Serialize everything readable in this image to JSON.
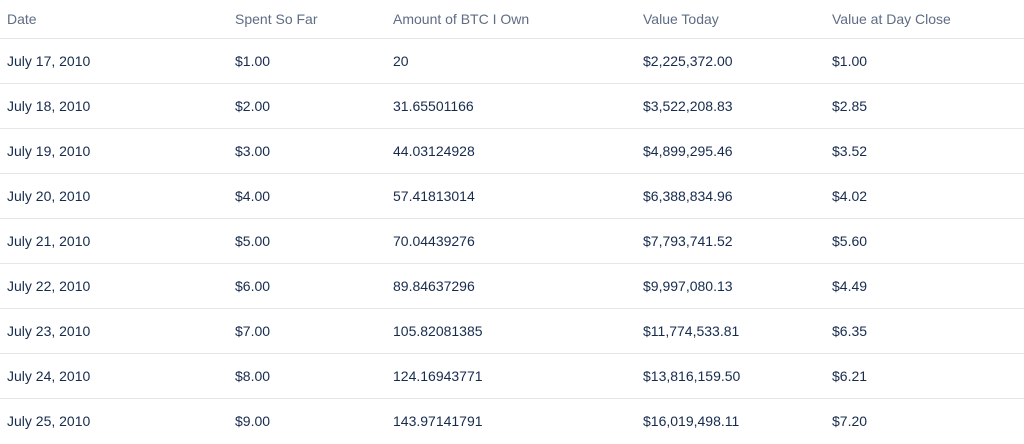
{
  "table": {
    "headers": [
      "Date",
      "Spent So Far",
      "Amount of BTC I Own",
      "Value Today",
      "Value at Day Close"
    ],
    "rows": [
      [
        "July 17, 2010",
        "$1.00",
        "20",
        "$2,225,372.00",
        "$1.00"
      ],
      [
        "July 18, 2010",
        "$2.00",
        "31.65501166",
        "$3,522,208.83",
        "$2.85"
      ],
      [
        "July 19, 2010",
        "$3.00",
        "44.03124928",
        "$4,899,295.46",
        "$3.52"
      ],
      [
        "July 20, 2010",
        "$4.00",
        "57.41813014",
        "$6,388,834.96",
        "$4.02"
      ],
      [
        "July 21, 2010",
        "$5.00",
        "70.04439276",
        "$7,793,741.52",
        "$5.60"
      ],
      [
        "July 22, 2010",
        "$6.00",
        "89.84637296",
        "$9,997,080.13",
        "$4.49"
      ],
      [
        "July 23, 2010",
        "$7.00",
        "105.82081385",
        "$11,774,533.81",
        "$6.35"
      ],
      [
        "July 24, 2010",
        "$8.00",
        "124.16943771",
        "$13,816,159.50",
        "$6.21"
      ],
      [
        "July 25, 2010",
        "$9.00",
        "143.97141791",
        "$16,019,498.11",
        "$7.20"
      ]
    ]
  },
  "colors": {
    "header_text": "#5e6c84",
    "cell_text": "#172b4d",
    "row_border": "#e4e6ea"
  }
}
